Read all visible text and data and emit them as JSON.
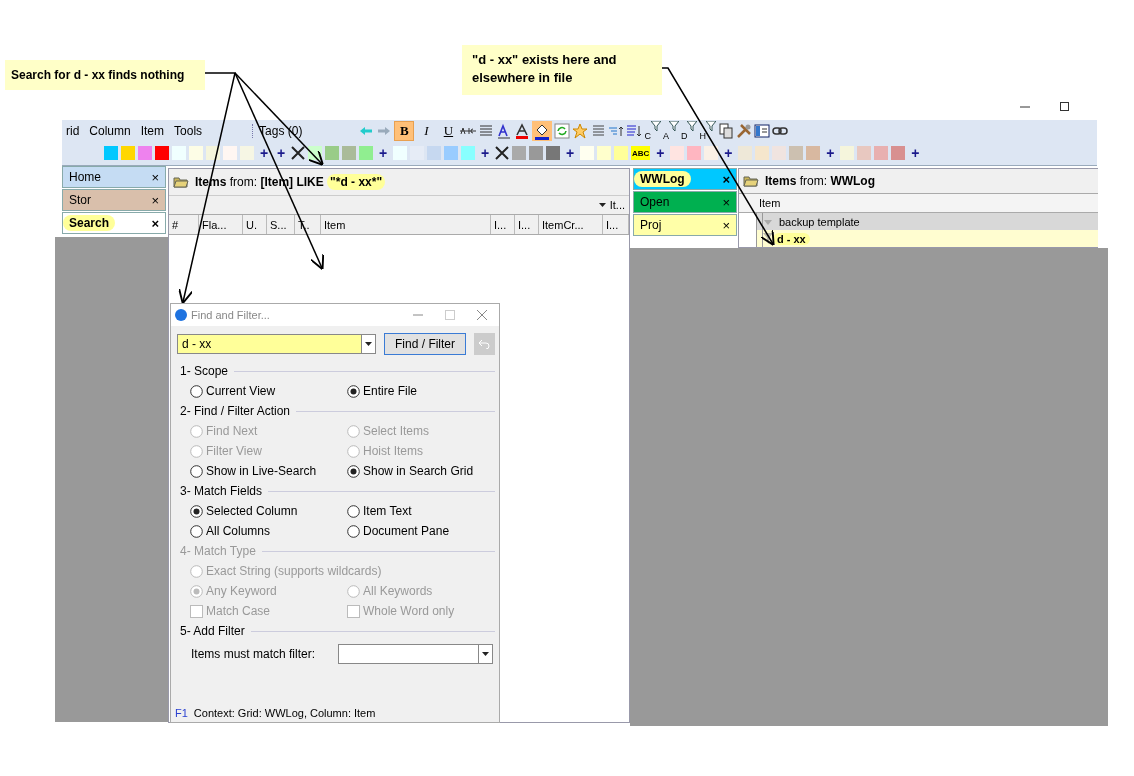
{
  "callouts": [
    {
      "text": "Search for d - xx finds nothing"
    },
    {
      "text": "\"d - xx\" exists here and elsewhere in file"
    }
  ],
  "menu": [
    "rid",
    "Column",
    "Item",
    "Tools"
  ],
  "tags_label": "Tags (0)",
  "format_buttons": [
    {
      "label": "B",
      "selected": true
    },
    {
      "label": "I",
      "selected": false
    },
    {
      "label": "U",
      "selected": false
    }
  ],
  "fill_color_active": true,
  "filters": [
    "C",
    "A",
    "D",
    "H"
  ],
  "swatches": [
    {
      "kind": "swatch",
      "color": "#00c8ff"
    },
    {
      "kind": "swatch",
      "color": "#ffd700"
    },
    {
      "kind": "swatch",
      "color": "#ee82ee"
    },
    {
      "kind": "swatch",
      "color": "#ff0000"
    },
    {
      "kind": "swatch",
      "color": "#f0ffff"
    },
    {
      "kind": "swatch",
      "color": "#fdfde6"
    },
    {
      "kind": "swatch",
      "color": "#f5f5dc"
    },
    {
      "kind": "swatch",
      "color": "#fff6f2"
    },
    {
      "kind": "swatch",
      "color": "#f6f6e4"
    },
    {
      "kind": "add",
      "label": "+"
    },
    {
      "kind": "add",
      "label": "+"
    },
    {
      "kind": "clear"
    },
    {
      "kind": "swatch",
      "color": "#ccffcc"
    },
    {
      "kind": "swatch",
      "color": "#99cc88"
    },
    {
      "kind": "swatch",
      "color": "#aabb99"
    },
    {
      "kind": "swatch",
      "color": "#90ee90"
    },
    {
      "kind": "add",
      "label": "+"
    },
    {
      "kind": "swatch",
      "color": "#f0ffff"
    },
    {
      "kind": "swatch",
      "color": "#e6ecf6"
    },
    {
      "kind": "swatch",
      "color": "#c6d8f0"
    },
    {
      "kind": "swatch",
      "color": "#99ccff"
    },
    {
      "kind": "swatch",
      "color": "#88ffff"
    },
    {
      "kind": "add",
      "label": "+"
    },
    {
      "kind": "clear"
    },
    {
      "kind": "swatch",
      "color": "#aaaaaa"
    },
    {
      "kind": "swatch",
      "color": "#999999"
    },
    {
      "kind": "swatch",
      "color": "#777777"
    },
    {
      "kind": "add",
      "label": "+"
    },
    {
      "kind": "swatch",
      "color": "#fffff0"
    },
    {
      "kind": "swatch",
      "color": "#ffffcc"
    },
    {
      "kind": "swatch",
      "color": "#ffff99"
    },
    {
      "kind": "sample",
      "label": "ABC",
      "color": "#ffff00"
    },
    {
      "kind": "add",
      "label": "+"
    },
    {
      "kind": "swatch",
      "color": "#ffe4e1"
    },
    {
      "kind": "swatch",
      "color": "#ffb6c1"
    },
    {
      "kind": "swatch",
      "color": "#faf0e6"
    },
    {
      "kind": "add",
      "label": "+"
    },
    {
      "kind": "swatch",
      "color": "#eee8d8"
    },
    {
      "kind": "swatch",
      "color": "#f5e6cc"
    },
    {
      "kind": "swatch",
      "color": "#f0e4e0"
    },
    {
      "kind": "swatch",
      "color": "#ccc0b0"
    },
    {
      "kind": "swatch",
      "color": "#d8b8a0"
    },
    {
      "kind": "add",
      "label": "+"
    },
    {
      "kind": "swatch",
      "color": "#f5f5dc"
    },
    {
      "kind": "swatch",
      "color": "#e8c8c0"
    },
    {
      "kind": "swatch",
      "color": "#e8b0b0"
    },
    {
      "kind": "swatch",
      "color": "#d89090"
    },
    {
      "kind": "add",
      "label": "+"
    }
  ],
  "left_tabs": [
    {
      "label": "Home",
      "color": "#c5dcf3",
      "selected": false,
      "close": "×"
    },
    {
      "label": "Stor",
      "color": "#d9bfab",
      "selected": false,
      "close": "×"
    },
    {
      "label": "Search",
      "color": "#ffffff",
      "selected": true,
      "close": "×"
    }
  ],
  "left_grid": {
    "title_lead": "Items",
    "title_from": "from:",
    "title_query": "[Item] LIKE",
    "title_term": "\"*d - xx*\"",
    "sub_column": "It...",
    "columns": [
      "#",
      "Fla...",
      "U.",
      "S...",
      "T..",
      "Item",
      "I...",
      "I...",
      "ItemCr...",
      "I..."
    ]
  },
  "right_tabs": [
    {
      "label": "WWLog",
      "color": "#00c8ff",
      "selected": true,
      "close": "×"
    },
    {
      "label": "Open",
      "color": "#00b050",
      "selected": false,
      "close": "×"
    },
    {
      "label": "Proj",
      "color": "#ffffa8",
      "selected": false,
      "close": "×"
    }
  ],
  "right_grid": {
    "title_lead": "Items",
    "title_from": "from:",
    "title_source": "WWLog",
    "column": "Item",
    "rows": [
      {
        "text": "backup template",
        "kind": "parent"
      },
      {
        "text": "d - xx",
        "kind": "match"
      }
    ]
  },
  "dialog": {
    "title": "Find and Filter...",
    "query": "d - xx",
    "find_button": "Find / Filter",
    "sections": [
      {
        "title": "1- Scope",
        "disabled": false,
        "rows": [
          [
            {
              "kind": "radio",
              "label": "Current View",
              "checked": false,
              "disabled": false
            },
            {
              "kind": "radio",
              "label": "Entire File",
              "checked": true,
              "disabled": false
            }
          ]
        ]
      },
      {
        "title": "2- Find / Filter Action",
        "disabled": false,
        "rows": [
          [
            {
              "kind": "radio",
              "label": "Find Next",
              "checked": false,
              "disabled": true
            },
            {
              "kind": "radio",
              "label": "Select Items",
              "checked": false,
              "disabled": true
            }
          ],
          [
            {
              "kind": "radio",
              "label": "Filter View",
              "checked": false,
              "disabled": true
            },
            {
              "kind": "radio",
              "label": "Hoist Items",
              "checked": false,
              "disabled": true
            }
          ],
          [
            {
              "kind": "radio",
              "label": "Show in Live-Search",
              "checked": false,
              "disabled": false
            },
            {
              "kind": "radio",
              "label": "Show in Search Grid",
              "checked": true,
              "disabled": false
            }
          ]
        ]
      },
      {
        "title": "3- Match Fields",
        "disabled": false,
        "rows": [
          [
            {
              "kind": "radio",
              "label": "Selected Column",
              "checked": true,
              "disabled": false
            },
            {
              "kind": "radio",
              "label": "Item Text",
              "checked": false,
              "disabled": false
            }
          ],
          [
            {
              "kind": "radio",
              "label": "All Columns",
              "checked": false,
              "disabled": false
            },
            {
              "kind": "radio",
              "label": "Document Pane",
              "checked": false,
              "disabled": false
            }
          ]
        ]
      },
      {
        "title": "4- Match Type",
        "disabled": true,
        "rows": [
          [
            {
              "kind": "radio",
              "label": "Exact String (supports wildcards)",
              "checked": false,
              "disabled": true
            }
          ],
          [
            {
              "kind": "radio",
              "label": "Any Keyword",
              "checked": true,
              "disabled": true
            },
            {
              "kind": "radio",
              "label": "All Keywords",
              "checked": false,
              "disabled": true
            }
          ],
          [
            {
              "kind": "checkbox",
              "label": "Match Case",
              "checked": false,
              "disabled": true
            },
            {
              "kind": "checkbox",
              "label": "Whole Word only",
              "checked": false,
              "disabled": true
            }
          ]
        ]
      },
      {
        "title": "5- Add Filter",
        "disabled": false,
        "field_label": "Items must match filter:"
      }
    ],
    "help_key": "F1",
    "context": "Context: Grid: WWLog, Column: Item"
  }
}
